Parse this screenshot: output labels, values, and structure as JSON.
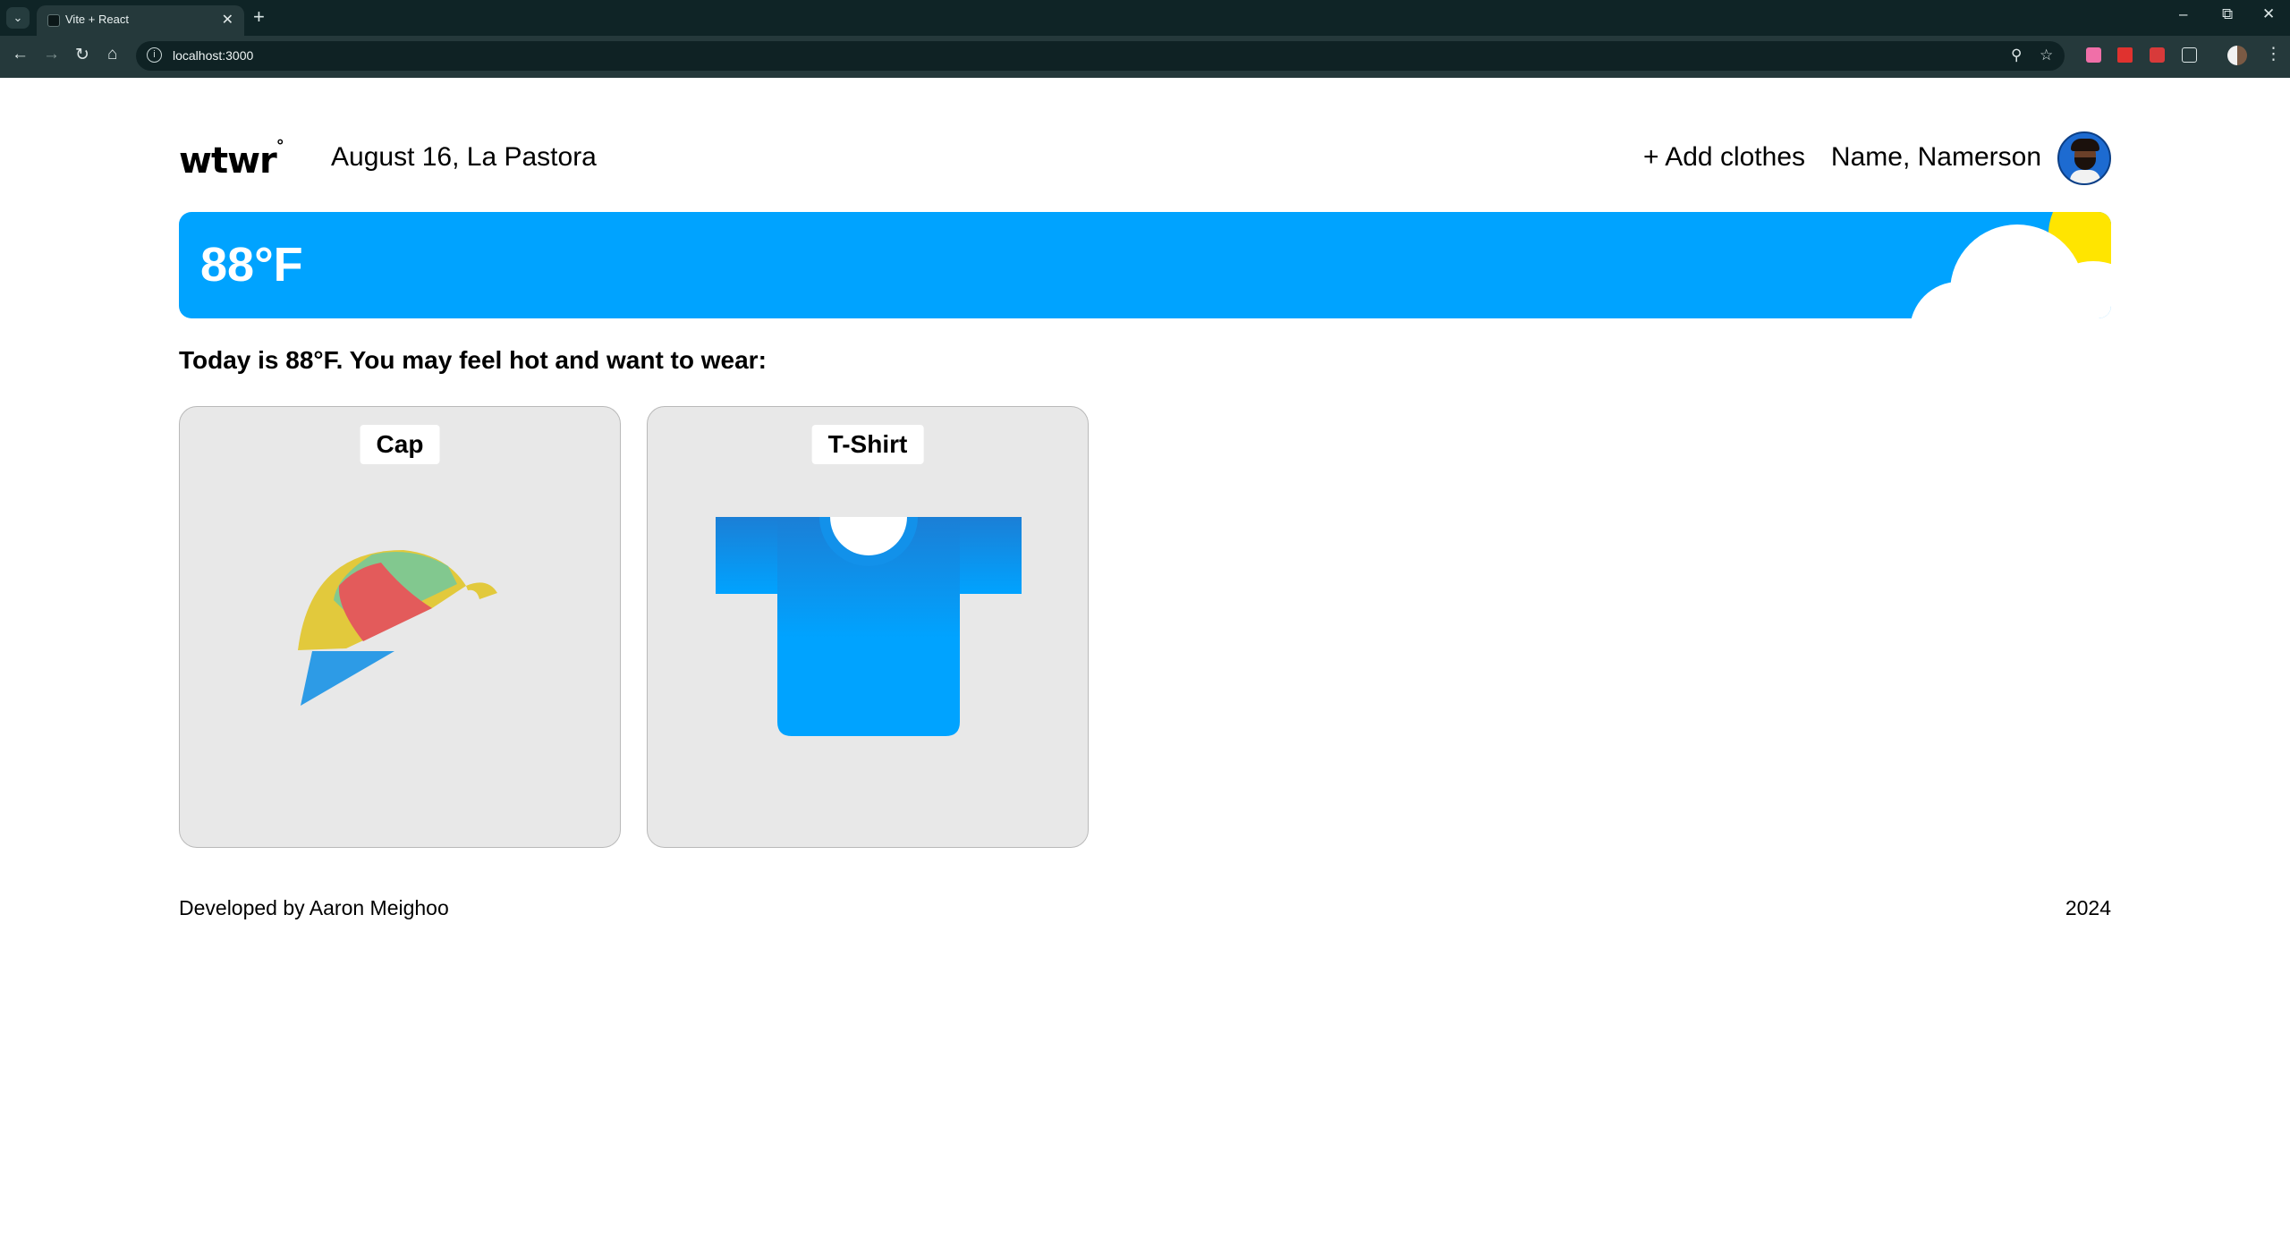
{
  "browser": {
    "tab_title": "Vite + React",
    "url": "localhost:3000"
  },
  "header": {
    "logo": "wtwr",
    "logo_degree": "°",
    "date_location": "August 16, La Pastora",
    "add_clothes": "+ Add clothes",
    "username": "Name, Namerson"
  },
  "weather": {
    "temperature": "88°F",
    "banner_color": "#00a3ff",
    "sun_color": "#ffe500"
  },
  "main": {
    "recommendation": "Today is 88°F. You may feel hot and want to wear:",
    "items": [
      {
        "name": "Cap",
        "icon": "cap-image"
      },
      {
        "name": "T-Shirt",
        "icon": "tshirt-image"
      }
    ]
  },
  "footer": {
    "developer": "Developed by Aaron Meighoo",
    "year": "2024"
  }
}
